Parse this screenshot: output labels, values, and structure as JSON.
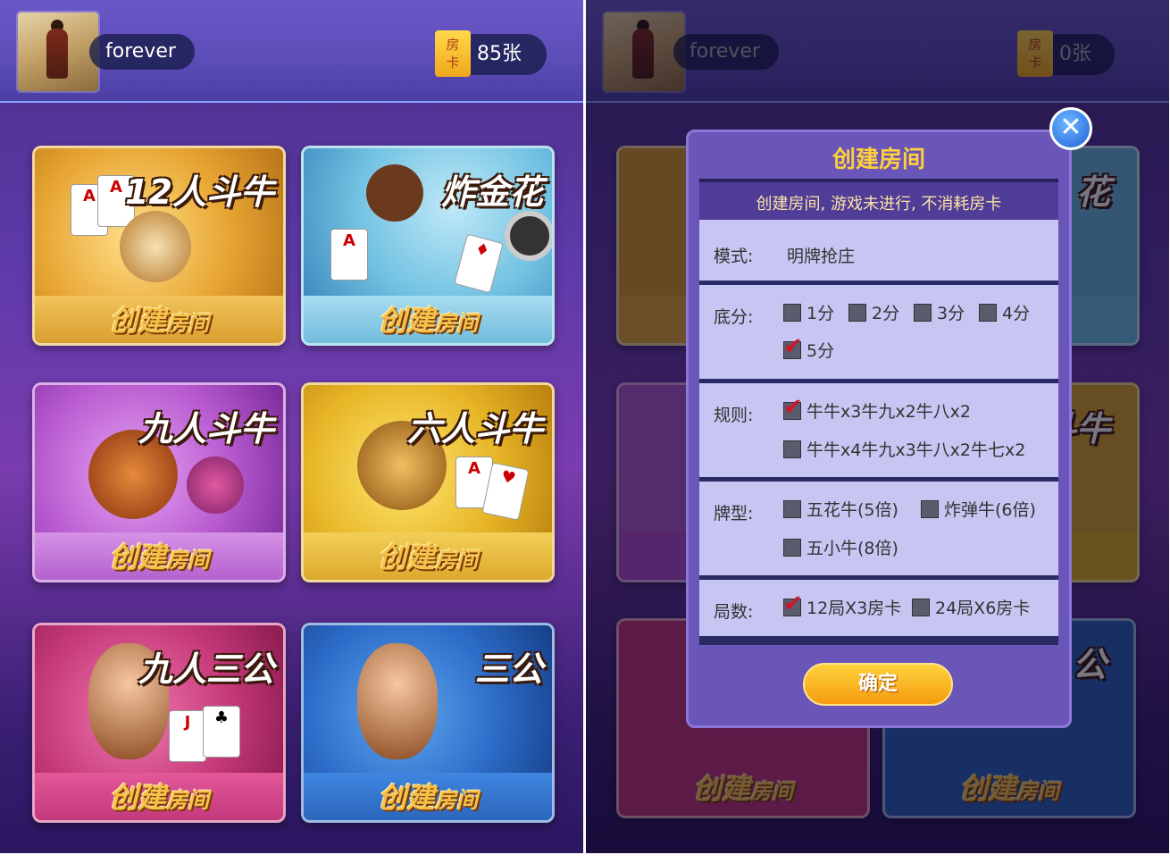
{
  "left": {
    "username": "forever",
    "card_icon_top": "房",
    "card_icon_bottom": "卡",
    "card_count": "85张",
    "games": [
      {
        "title": "12人斗牛",
        "button_main": "创建",
        "button_small": "房间"
      },
      {
        "title": "炸金花",
        "button_main": "创建",
        "button_small": "房间"
      },
      {
        "title": "九人斗牛",
        "button_main": "创建",
        "button_small": "房间"
      },
      {
        "title": "六人斗牛",
        "button_main": "创建",
        "button_small": "房间"
      },
      {
        "title": "九人三公",
        "button_main": "创建",
        "button_small": "房间"
      },
      {
        "title": "三公",
        "button_main": "创建",
        "button_small": "房间"
      }
    ]
  },
  "right": {
    "username": "forever",
    "card_icon_top": "房",
    "card_icon_bottom": "卡",
    "card_count": "0张",
    "bg_fragments": [
      "花",
      "斗牛",
      "公"
    ],
    "bg_buttons": [
      {
        "button_main": "创建",
        "button_small": "房间"
      },
      {
        "button_main": "创建",
        "button_small": "房间"
      }
    ]
  },
  "dialog": {
    "title": "创建房间",
    "close_symbol": "✕",
    "notice": "创建房间, 游戏未进行, 不消耗房卡",
    "mode": {
      "label": "模式:",
      "value": "明牌抢庄"
    },
    "base_score": {
      "label": "底分:",
      "options": [
        {
          "text": "1分",
          "checked": false
        },
        {
          "text": "2分",
          "checked": false
        },
        {
          "text": "3分",
          "checked": false
        },
        {
          "text": "4分",
          "checked": false
        },
        {
          "text": "5分",
          "checked": true
        }
      ]
    },
    "rules": {
      "label": "规则:",
      "options": [
        {
          "text": "牛牛x3牛九x2牛八x2",
          "checked": true
        },
        {
          "text": "牛牛x4牛九x3牛八x2牛七x2",
          "checked": false
        }
      ]
    },
    "card_type": {
      "label": "牌型:",
      "options": [
        {
          "text": "五花牛(5倍)",
          "checked": false
        },
        {
          "text": "炸弹牛(6倍)",
          "checked": false
        },
        {
          "text": "五小牛(8倍)",
          "checked": false
        }
      ]
    },
    "rounds": {
      "label": "局数:",
      "options": [
        {
          "text": "12局X3房卡",
          "checked": true
        },
        {
          "text": "24局X6房卡",
          "checked": false
        }
      ]
    },
    "confirm_label": "确定",
    "check_mark": "✔"
  },
  "colors": {
    "accent_gold": "#ffcf3d",
    "dialog_bg": "#6a55b8",
    "form_bg": "#c7c5f1",
    "check_red": "#d0142a",
    "close_blue": "#1e62d8"
  }
}
